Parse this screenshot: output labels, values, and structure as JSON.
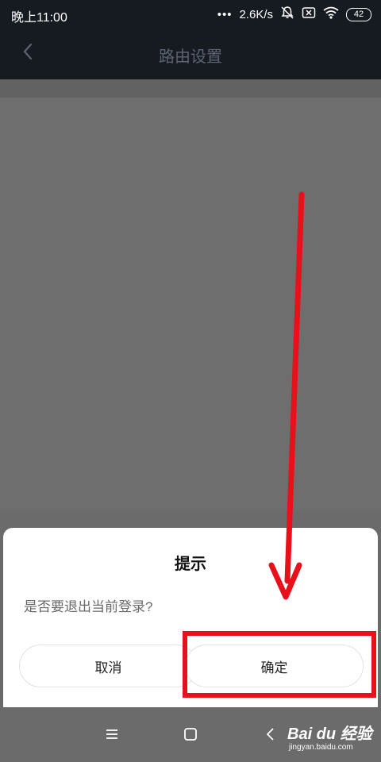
{
  "status_bar": {
    "time": "晚上11:00",
    "dots": "•••",
    "net_speed": "2.6K/s",
    "battery": "42"
  },
  "app_bar": {
    "title": "路由设置"
  },
  "dialog": {
    "title": "提示",
    "message": "是否要退出当前登录?",
    "cancel_label": "取消",
    "confirm_label": "确定"
  },
  "watermark": {
    "logo": "Bai du 经验",
    "sub": "jingyan.baidu.com"
  },
  "colors": {
    "annotation": "#e8101a",
    "appbar_bg": "#161b22",
    "overlay": "#6b6b6b"
  },
  "icons": {
    "back": "chevron-left-icon",
    "bell_off": "bell-off-icon",
    "wifi": "wifi-icon",
    "sim": "no-sim-icon"
  }
}
